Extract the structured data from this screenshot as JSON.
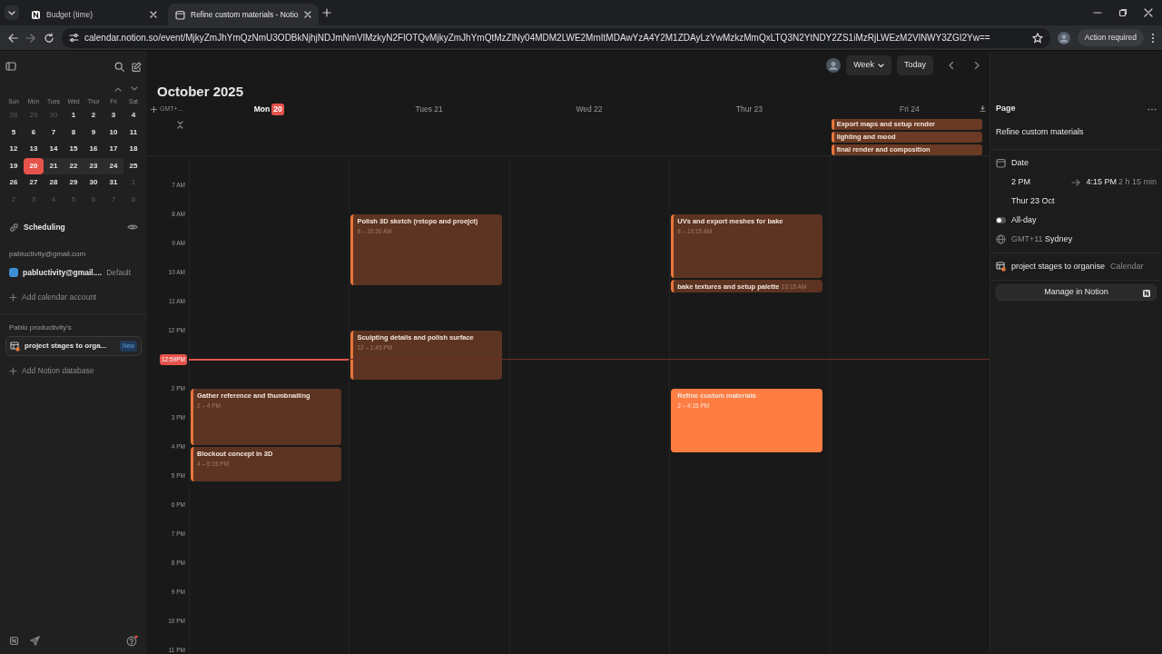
{
  "browser": {
    "tabs": [
      {
        "title": "Budget (time)",
        "selected": false
      },
      {
        "title": "Refine custom materials - Notio",
        "selected": true
      }
    ],
    "url": "calendar.notion.so/event/MjkyZmJhYmQzNmU3ODBkNjhjNDJmNmVlMzkyN2FlOTQvMjkyZmJhYmQtMzZlNy04MDM2LWE2MmItMDAwYzA4Y2M1ZDAyLzYwMzkzMmQxLTQ3N2YtNDY2ZS1iMzRjLWEzM2VlNWY3ZGI2Yw==",
    "profile_status": "Action required"
  },
  "sidebar": {
    "mini_calendar": {
      "weekdays": [
        "Sun",
        "Mon",
        "Tues",
        "Wed",
        "Thur",
        "Fri",
        "Sat"
      ],
      "weeks": [
        [
          {
            "label": "28",
            "muted": true,
            "selected": false,
            "in_week": false
          },
          {
            "label": "29",
            "muted": true,
            "selected": false,
            "in_week": false
          },
          {
            "label": "30",
            "muted": true,
            "selected": false,
            "in_week": false
          },
          {
            "label": "1",
            "muted": false,
            "selected": false,
            "in_week": false
          },
          {
            "label": "2",
            "muted": false,
            "selected": false,
            "in_week": false
          },
          {
            "label": "3",
            "muted": false,
            "selected": false,
            "in_week": false
          },
          {
            "label": "4",
            "muted": false,
            "selected": false,
            "in_week": false
          }
        ],
        [
          {
            "label": "5",
            "muted": false,
            "selected": false,
            "in_week": false
          },
          {
            "label": "6",
            "muted": false,
            "selected": false,
            "in_week": false
          },
          {
            "label": "7",
            "muted": false,
            "selected": false,
            "in_week": false
          },
          {
            "label": "8",
            "muted": false,
            "selected": false,
            "in_week": false
          },
          {
            "label": "9",
            "muted": false,
            "selected": false,
            "in_week": false
          },
          {
            "label": "10",
            "muted": false,
            "selected": false,
            "in_week": false
          },
          {
            "label": "11",
            "muted": false,
            "selected": false,
            "in_week": false
          }
        ],
        [
          {
            "label": "12",
            "muted": false,
            "selected": false,
            "in_week": false
          },
          {
            "label": "13",
            "muted": false,
            "selected": false,
            "in_week": false
          },
          {
            "label": "14",
            "muted": false,
            "selected": false,
            "in_week": false
          },
          {
            "label": "15",
            "muted": false,
            "selected": false,
            "in_week": false
          },
          {
            "label": "16",
            "muted": false,
            "selected": false,
            "in_week": false
          },
          {
            "label": "17",
            "muted": false,
            "selected": false,
            "in_week": false
          },
          {
            "label": "18",
            "muted": false,
            "selected": false,
            "in_week": false
          }
        ],
        [
          {
            "label": "19",
            "muted": false,
            "selected": false,
            "in_week": false
          },
          {
            "label": "20",
            "muted": false,
            "selected": true,
            "in_week": true
          },
          {
            "label": "21",
            "muted": false,
            "selected": false,
            "in_week": true
          },
          {
            "label": "22",
            "muted": false,
            "selected": false,
            "in_week": true
          },
          {
            "label": "23",
            "muted": false,
            "selected": false,
            "in_week": true
          },
          {
            "label": "24",
            "muted": false,
            "selected": false,
            "in_week": true
          },
          {
            "label": "25",
            "muted": false,
            "selected": false,
            "in_week": false
          }
        ],
        [
          {
            "label": "26",
            "muted": false,
            "selected": false,
            "in_week": false
          },
          {
            "label": "27",
            "muted": false,
            "selected": false,
            "in_week": false
          },
          {
            "label": "28",
            "muted": false,
            "selected": false,
            "in_week": false
          },
          {
            "label": "29",
            "muted": false,
            "selected": false,
            "in_week": false
          },
          {
            "label": "30",
            "muted": false,
            "selected": false,
            "in_week": false
          },
          {
            "label": "31",
            "muted": false,
            "selected": false,
            "in_week": false
          },
          {
            "label": "1",
            "muted": true,
            "selected": false,
            "in_week": false
          }
        ],
        [
          {
            "label": "2",
            "muted": true,
            "selected": false,
            "in_week": false
          },
          {
            "label": "3",
            "muted": true,
            "selected": false,
            "in_week": false
          },
          {
            "label": "4",
            "muted": true,
            "selected": false,
            "in_week": false
          },
          {
            "label": "5",
            "muted": true,
            "selected": false,
            "in_week": false
          },
          {
            "label": "6",
            "muted": true,
            "selected": false,
            "in_week": false
          },
          {
            "label": "7",
            "muted": true,
            "selected": false,
            "in_week": false
          },
          {
            "label": "8",
            "muted": true,
            "selected": false,
            "in_week": false
          }
        ]
      ]
    },
    "scheduling": "Scheduling",
    "account_heading": "pabluctivity@gmail.com",
    "accounts": [
      {
        "name": "pabluctivity@gmail....",
        "badge": "Default",
        "color": "#3d8fd6"
      }
    ],
    "add_account": "Add calendar account",
    "workspace_heading": "Pablo productivity's",
    "databases": [
      {
        "name": "project stages to orga...",
        "badge": "New",
        "selected": true
      }
    ],
    "add_database": "Add Notion database"
  },
  "calendar": {
    "view": "Week",
    "today_button": "Today",
    "title": "October 2025",
    "timezone": "GMT+...",
    "days": [
      {
        "name": "Mon",
        "number": "20",
        "today": true,
        "events": [
          {
            "kind": "block",
            "title": "Gather reference and thumbnailing",
            "time": "2 – 4 PM",
            "selected": false
          },
          {
            "kind": "block",
            "title": "Blockout concept in 3D",
            "time": "4 – 5:15 PM",
            "selected": false
          }
        ]
      },
      {
        "name": "Tues",
        "number": "21",
        "today": false,
        "events": [
          {
            "kind": "block",
            "title": "Polish 3D sketch (retopo and proejct)",
            "time": "8 – 10:30 AM",
            "selected": false
          },
          {
            "kind": "block",
            "title": "Sculpting details and polish surface",
            "time": "12 – 1:45 PM",
            "selected": false
          }
        ]
      },
      {
        "name": "Wed",
        "number": "22",
        "today": false
      },
      {
        "name": "Thur",
        "number": "23",
        "today": false,
        "events": [
          {
            "kind": "block",
            "title": "UVs and export meshes for bake",
            "time": "8 – 10:15 AM",
            "selected": false
          },
          {
            "kind": "short",
            "title": "bake textures and setup palette",
            "time": "10:15 AM",
            "selected": false
          },
          {
            "kind": "block",
            "title": "Refine custom materials",
            "time": "2 – 4:15 PM",
            "selected": true
          }
        ]
      },
      {
        "name": "Fri",
        "number": "24",
        "today": false,
        "all_day_events": [
          {
            "title": "Export maps and setup render"
          },
          {
            "title": "lighting and mood"
          },
          {
            "title": "final render and composition"
          }
        ]
      }
    ],
    "hours": [
      "7 AM",
      "8 AM",
      "9 AM",
      "10 AM",
      "11 AM",
      "12 PM",
      "2 PM",
      "3 PM",
      "4 PM",
      "5 PM",
      "6 PM",
      "7 PM",
      "8 PM",
      "9 PM",
      "10 PM",
      "11 PM"
    ],
    "now_label": "12:59PM"
  },
  "panel": {
    "heading": "Page",
    "title": "Refine custom materials",
    "date_label": "Date",
    "start": "2 PM",
    "end": "4:15 PM",
    "duration": "2 h 15 min",
    "day": "Thur 23 Oct",
    "all_day": {
      "label": "All-day",
      "on": false
    },
    "timezone_offset": "GMT+11",
    "timezone_city": "Sydney",
    "database": "project stages to organise",
    "database_type": "Calendar",
    "button": "Manage in Notion"
  }
}
